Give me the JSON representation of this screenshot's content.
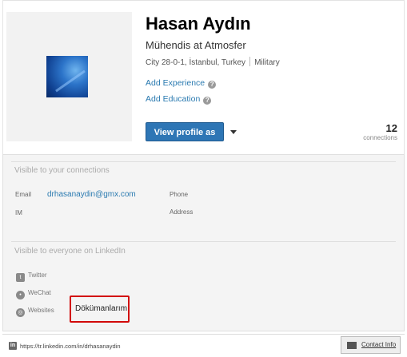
{
  "profile": {
    "name": "Hasan Aydın",
    "headline": "Mühendis at Atmosfer",
    "location": "City 28-0-1, İstanbul, Turkey",
    "industry": "Military",
    "add_experience": "Add Experience",
    "add_education": "Add Education",
    "view_profile_button": "View profile as",
    "connections_count": "12",
    "connections_label": "connections"
  },
  "contact": {
    "visible_connections_title": "Visible to your connections",
    "email_label": "Email",
    "email_value": "drhasanaydin@gmx.com",
    "phone_label": "Phone",
    "im_label": "IM",
    "address_label": "Address",
    "visible_everyone_title": "Visible to everyone on LinkedIn",
    "twitter_label": "Twitter",
    "wechat_label": "WeChat",
    "websites_label": "Websites",
    "website_value": "Dökümanlarım"
  },
  "footer": {
    "url": "https://tr.linkedin.com/in/drhasanaydin",
    "contact_info_button": "Contact Info"
  },
  "colors": {
    "primary_button": "#2e76b5",
    "link": "#2a7ab0",
    "highlight_box": "#d20a0a"
  },
  "icons": {
    "help": "question-circle-icon",
    "dropdown": "caret-down-icon",
    "twitter": "twitter-icon",
    "wechat": "wechat-icon",
    "websites": "globe-icon",
    "linkedin": "linkedin-icon",
    "contact_card": "contact-card-icon"
  }
}
